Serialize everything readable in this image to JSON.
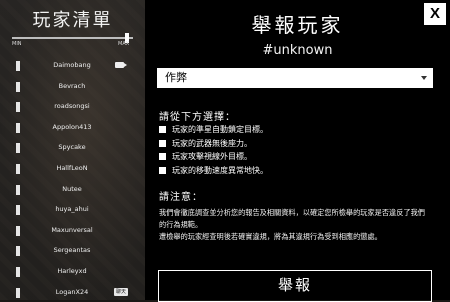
{
  "player_list": {
    "title": "玩家清單",
    "slider": {
      "min_label": "MIN",
      "max_label": "MAX",
      "value_fraction": 0.95
    },
    "players": [
      {
        "name": "Daimobang",
        "badge_icon": "camera-icon"
      },
      {
        "name": "Bevrach"
      },
      {
        "name": "roadsongsi"
      },
      {
        "name": "Appolon413"
      },
      {
        "name": "Spycake"
      },
      {
        "name": "HallfLeoN"
      },
      {
        "name": "Nutee"
      },
      {
        "name": "huya_ahui"
      },
      {
        "name": "Maxunversal"
      },
      {
        "name": "Sergeantas"
      },
      {
        "name": "Harleyxd"
      },
      {
        "name": "LoganX24",
        "badge_text": "聊天"
      }
    ]
  },
  "report": {
    "title": "舉報玩家",
    "target": "#unknown",
    "close_label": "X",
    "reason_select": {
      "value": "作弊"
    },
    "choose_label": "請從下方選擇：",
    "options": [
      "玩家的準星自動鎖定目標。",
      "玩家的武器無後座力。",
      "玩家攻擊視線外目標。",
      "玩家的移動速度異常地快。"
    ],
    "note_label": "請注意：",
    "note_paragraphs": [
      "我們會徹底調查並分析您的報告及相關資料，以確定您所檢舉的玩家是否違反了我們的行為規範。",
      "遭檢舉的玩家經查明後若確實違規，將為其違規行為受到相應的懲處。"
    ],
    "submit_label": "舉報"
  }
}
